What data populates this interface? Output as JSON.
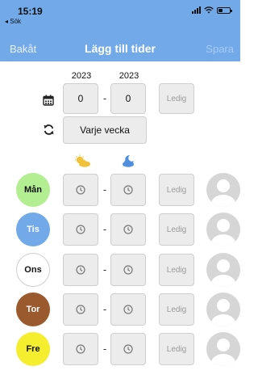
{
  "status_bar": {
    "time": "15:19",
    "back_app": "◂ Sök"
  },
  "nav": {
    "left": "Bakåt",
    "title": "Lägg till tider",
    "right": "Spara"
  },
  "weeks": {
    "year_from": "2023",
    "year_to": "2023",
    "from_value": "0",
    "to_value": "0",
    "separator": "-",
    "ledig_label": "Ledig"
  },
  "repeat": {
    "label": "Varje vecka"
  },
  "icons": {
    "calendar": "calendar-icon",
    "repeat": "repeat-icon",
    "day_start": "sun-cloud-icon",
    "day_end": "moon-cloud-icon",
    "clock": "clock-icon",
    "avatar": "user-avatar-icon"
  },
  "days": [
    {
      "label": "Mån",
      "color": "#b3ee92",
      "text_color": "#111111",
      "bordered": false,
      "ledig": "Ledig",
      "separator": "-"
    },
    {
      "label": "Tis",
      "color": "#72a9e8",
      "text_color": "#ffffff",
      "bordered": false,
      "ledig": "Ledig",
      "separator": "-"
    },
    {
      "label": "Ons",
      "color": "#ffffff",
      "text_color": "#111111",
      "bordered": true,
      "ledig": "Ledig",
      "separator": "-"
    },
    {
      "label": "Tor",
      "color": "#9a5a2d",
      "text_color": "#ffffff",
      "bordered": false,
      "ledig": "Ledig",
      "separator": "-"
    },
    {
      "label": "Fre",
      "color": "#f5ee2e",
      "text_color": "#111111",
      "bordered": false,
      "ledig": "Ledig",
      "separator": "-"
    }
  ],
  "colors": {
    "header": "#72a9e8",
    "sun": "#f0c23a",
    "moon": "#4f8fe0"
  }
}
